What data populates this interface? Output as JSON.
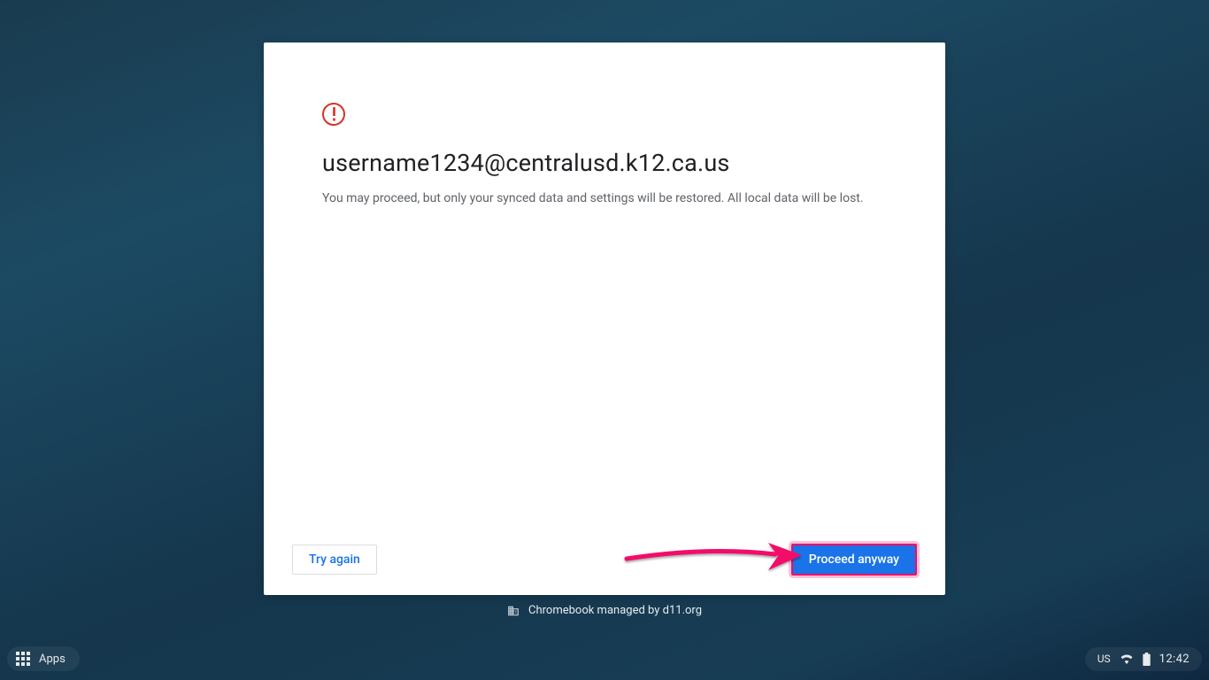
{
  "dialog": {
    "email": "username1234@centralusd.k12.ca.us",
    "body": "You may proceed, but only your synced data and settings will be restored. All local data will be lost.",
    "try_again_label": "Try again",
    "proceed_label": "Proceed anyway"
  },
  "managed_text": "Chromebook managed by d11.org",
  "shelf": {
    "apps_label": "Apps"
  },
  "status": {
    "ime": "US",
    "time": "12:42"
  },
  "colors": {
    "accent": "#1a73e8",
    "warn": "#d93025",
    "annotation": "#f20b67"
  }
}
